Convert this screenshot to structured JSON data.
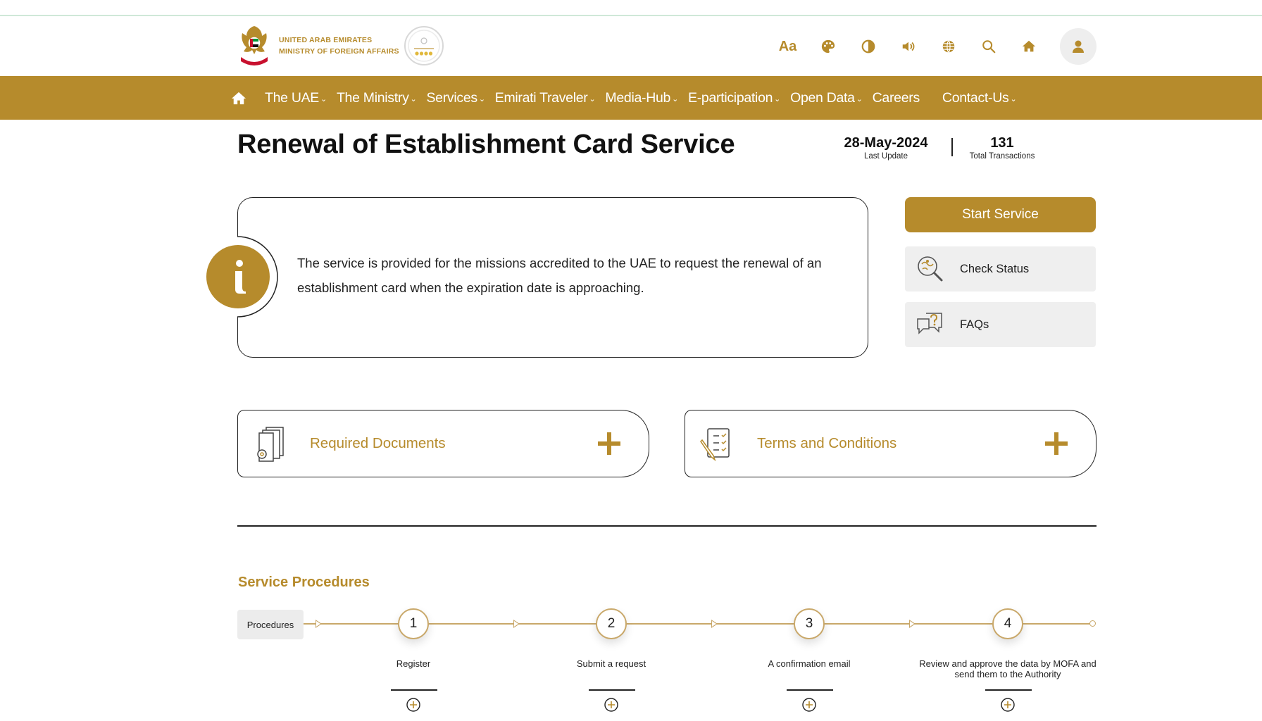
{
  "header": {
    "logo_line1": "UNITED ARAB EMIRATES",
    "logo_line2": "MINISTRY OF FOREIGN AFFAIRS",
    "tools": [
      {
        "icon": "font-size-icon",
        "label": "Aa"
      },
      {
        "icon": "palette-icon",
        "label": ""
      },
      {
        "icon": "contrast-icon",
        "label": ""
      },
      {
        "icon": "speaker-icon",
        "label": ""
      },
      {
        "icon": "globe-icon",
        "label": ""
      },
      {
        "icon": "search-icon",
        "label": ""
      },
      {
        "icon": "home-icon",
        "label": ""
      }
    ],
    "user_icon": "user-icon"
  },
  "nav": {
    "items": [
      {
        "label": "The UAE",
        "dropdown": true
      },
      {
        "label": "The Ministry",
        "dropdown": true
      },
      {
        "label": "Services",
        "dropdown": true
      },
      {
        "label": "Emirati Traveler",
        "dropdown": true
      },
      {
        "label": "Media-Hub",
        "dropdown": true
      },
      {
        "label": "E-participation",
        "dropdown": true
      },
      {
        "label": "Open Data",
        "dropdown": true
      },
      {
        "label": "Careers",
        "dropdown": false
      },
      {
        "label": "Contact-Us",
        "dropdown": true
      }
    ],
    "chevron": "⌄"
  },
  "page": {
    "title": "Renewal of Establishment Card Service",
    "last_update_value": "28-May-2024",
    "last_update_label": "Last Update",
    "transactions_value": "131",
    "transactions_label": "Total Transactions"
  },
  "info": {
    "text": "The service is provided for the missions accredited to the UAE to request the renewal of an establishment card when the expiration date is approaching."
  },
  "actions": {
    "start_label": "Start Service",
    "check_status_label": "Check Status",
    "faqs_label": "FAQs"
  },
  "accordions": {
    "required_documents": "Required Documents",
    "terms": "Terms and Conditions"
  },
  "procedures": {
    "title": "Service Procedures",
    "tag": "Procedures",
    "steps": [
      {
        "number": "1",
        "label": "Register"
      },
      {
        "number": "2",
        "label": "Submit a request"
      },
      {
        "number": "3",
        "label": "A confirmation email"
      },
      {
        "number": "4",
        "label": "Review and approve the data by MOFA and send them to the Authority"
      }
    ]
  },
  "colors": {
    "brand_gold": "#b68b2c",
    "accent_line": "#c9a86a",
    "button_grey": "#efefef"
  }
}
